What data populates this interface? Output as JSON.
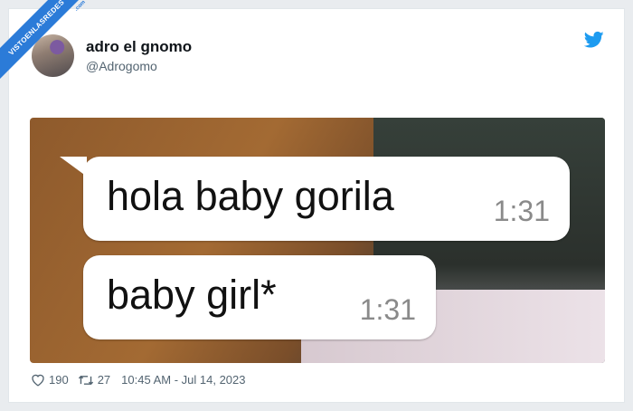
{
  "watermark": {
    "text": "VISTOENLASREDES",
    "suffix": ".com"
  },
  "author": {
    "name": "adro el gnomo",
    "handle": "@Adrogomo"
  },
  "icons": {
    "platform": "twitter-bird-icon",
    "like": "heart-icon",
    "retweet": "retweet-icon"
  },
  "colors": {
    "brand": "#1d9bf0",
    "banner": "#2b7bd8"
  },
  "messages": [
    {
      "text": "hola baby gorila",
      "time": "1:31"
    },
    {
      "text": "baby girl*",
      "time": "1:31"
    }
  ],
  "stats": {
    "likes": "190",
    "retweets": "27",
    "timestamp": "10:45 AM - Jul 14, 2023"
  }
}
